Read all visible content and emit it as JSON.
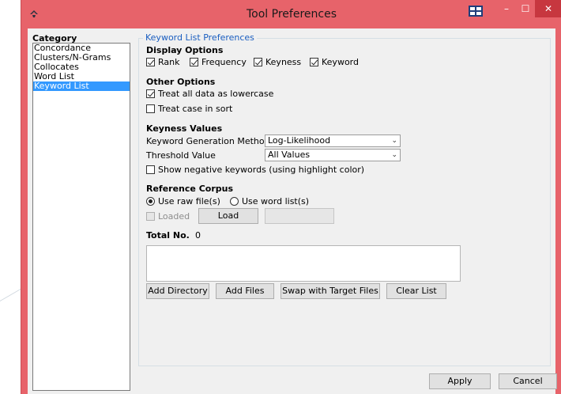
{
  "window": {
    "title": "Tool Preferences",
    "min_glyph": "–",
    "max_glyph": "☐",
    "close_glyph": "✕"
  },
  "category": {
    "title": "Category",
    "items": [
      "Concordance",
      "Clusters/N-Grams",
      "Collocates",
      "Word List",
      "Keyword List"
    ],
    "selected": "Keyword List"
  },
  "prefs": {
    "legend": "Keyword List Preferences",
    "display_options": {
      "heading": "Display Options",
      "rank": "Rank",
      "frequency": "Frequency",
      "keyness": "Keyness",
      "keyword": "Keyword"
    },
    "other_options": {
      "heading": "Other Options",
      "lowercase": "Treat all data as lowercase",
      "case_sort": "Treat case in sort"
    },
    "keyness_values": {
      "heading": "Keyness Values",
      "method_label": "Keyword Generation Method",
      "method_value": "Log-Likelihood",
      "threshold_label": "Threshold Value",
      "threshold_value": "All Values",
      "negative": "Show negative keywords (using highlight color)"
    },
    "reference_corpus": {
      "heading": "Reference Corpus",
      "raw_files": "Use raw file(s)",
      "word_list": "Use word list(s)",
      "loaded": "Loaded",
      "load_button": "Load"
    },
    "total": {
      "label": "Total No.",
      "value": "0"
    },
    "buttons": {
      "add_directory": "Add Directory",
      "add_files": "Add Files",
      "swap": "Swap with Target Files",
      "clear": "Clear List"
    }
  },
  "footer": {
    "apply": "Apply",
    "cancel": "Cancel"
  },
  "colors": {
    "titlebar": "#e7636a",
    "selection": "#3399ff",
    "legend": "#1a5ec0"
  }
}
